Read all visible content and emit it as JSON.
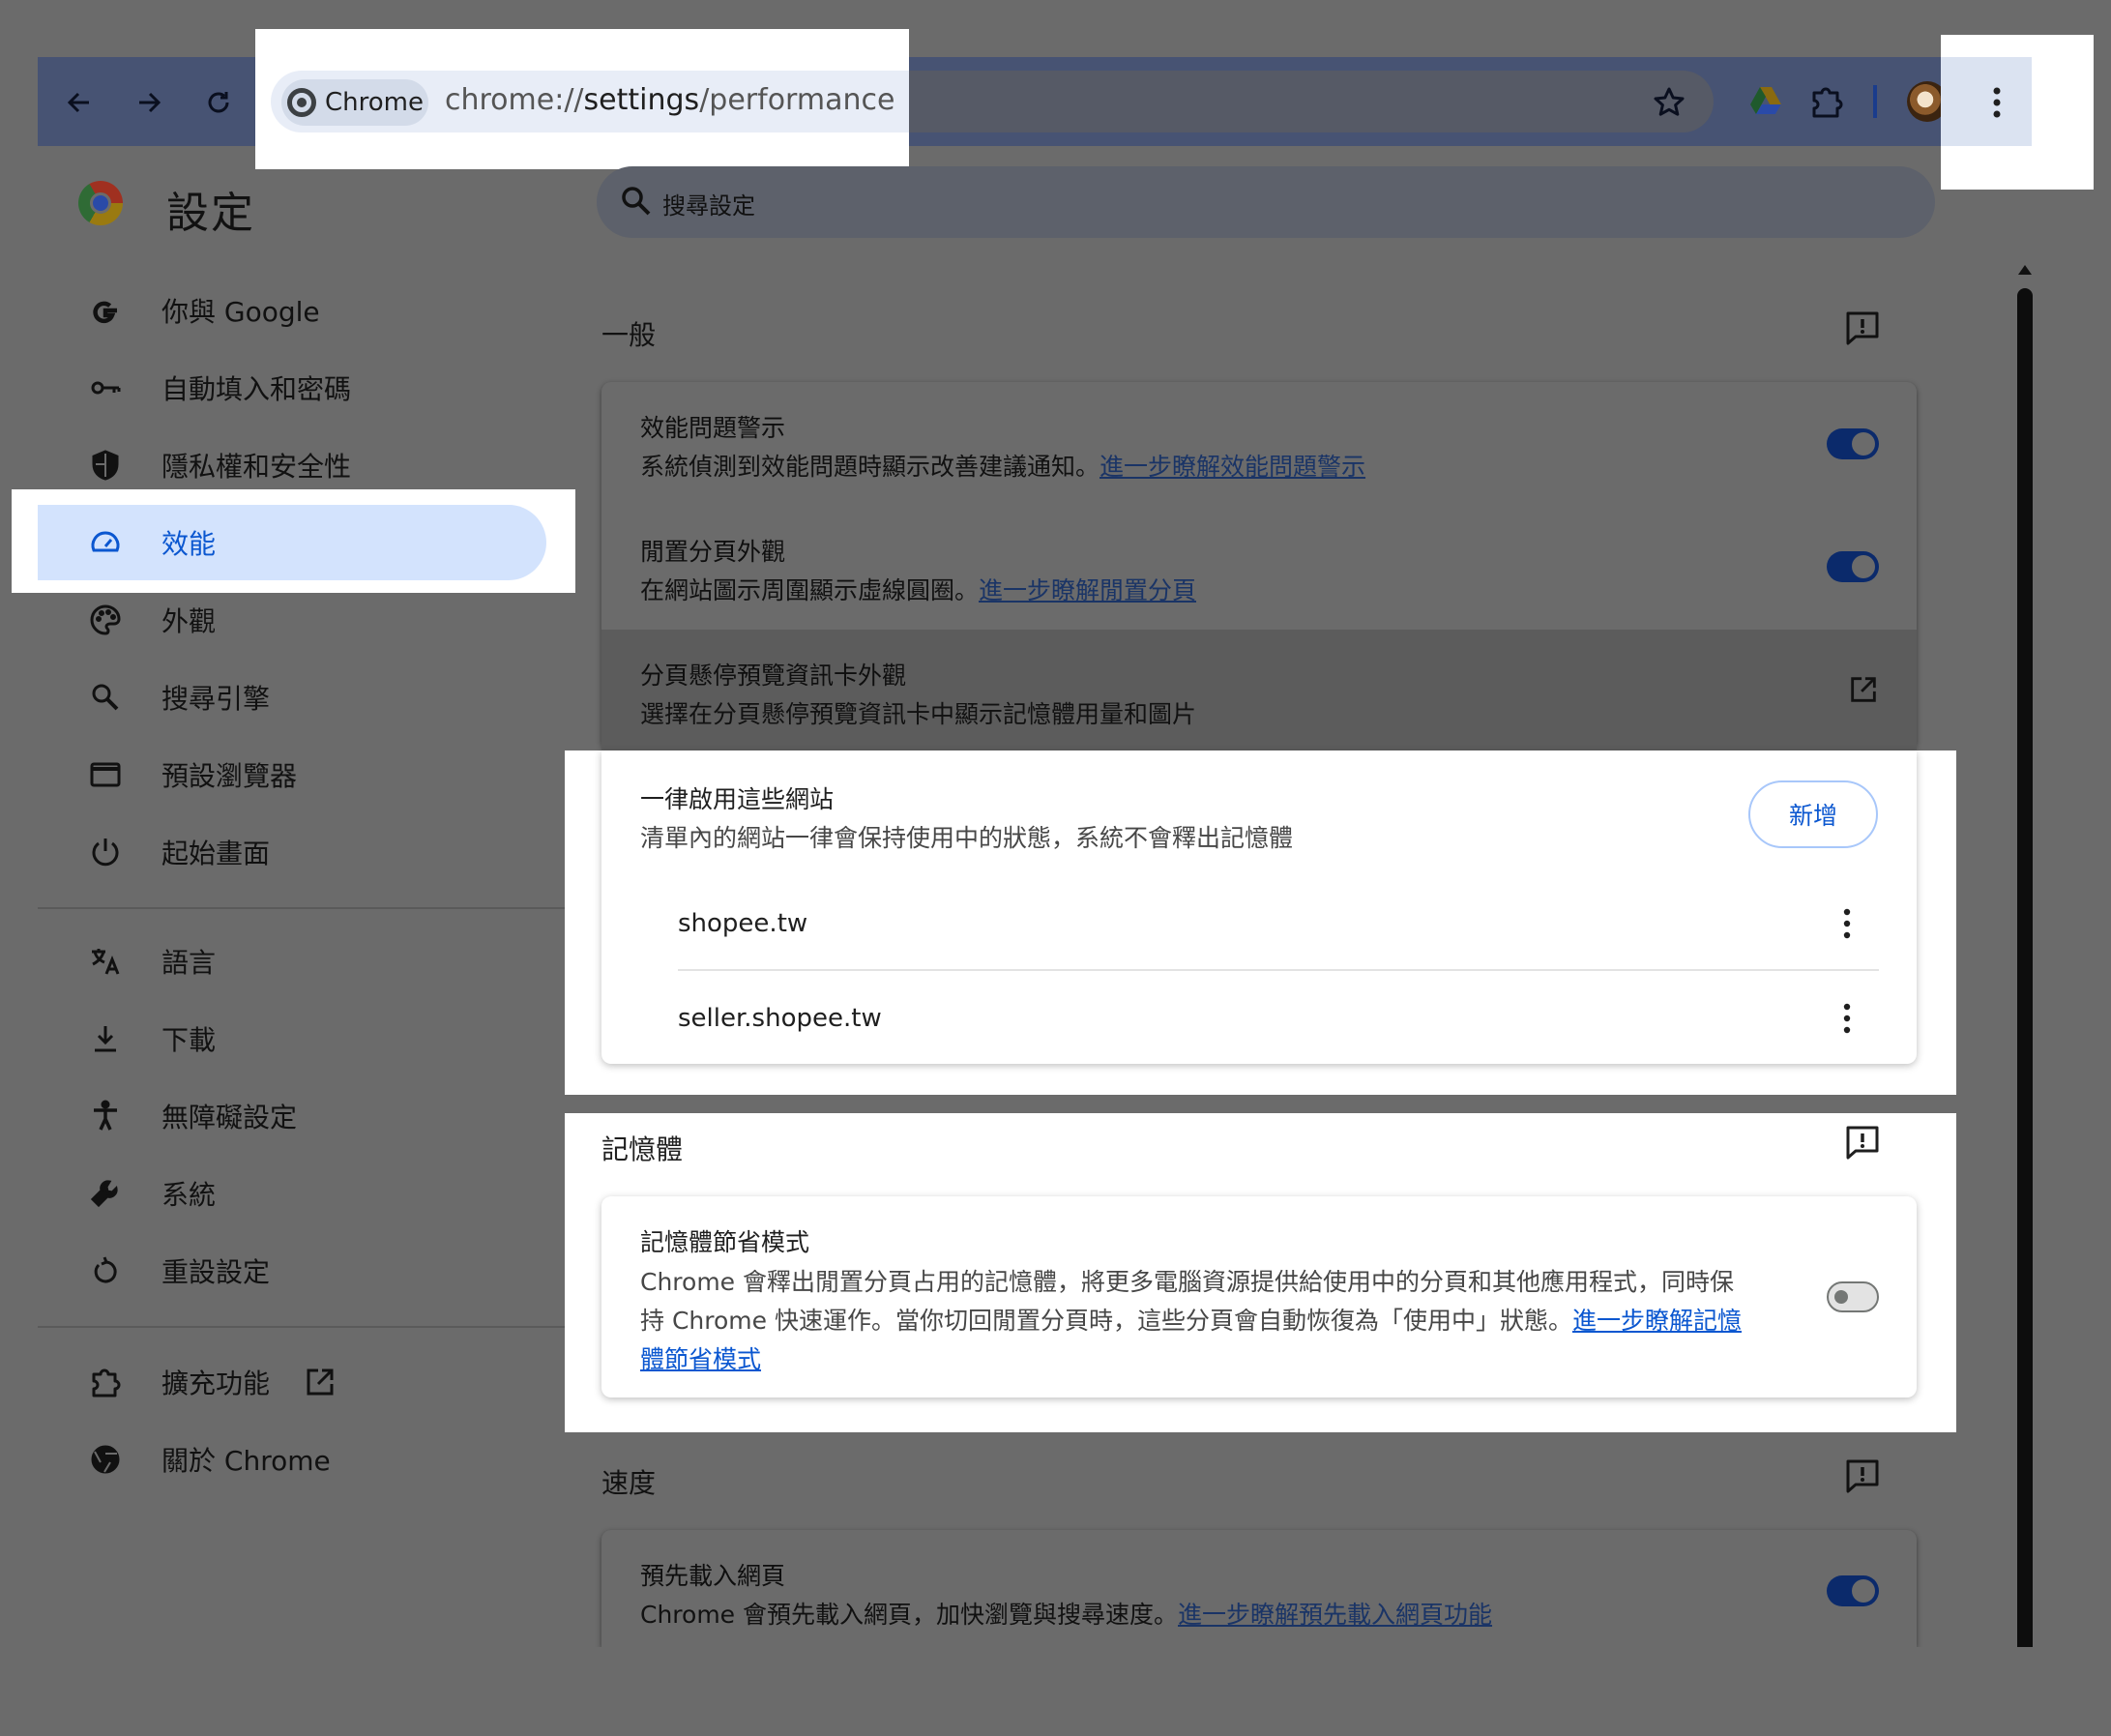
{
  "toolbar": {
    "chip_label": "Chrome",
    "url_prefix": "chrome://",
    "url_path": "settings",
    "url_suffix": "/performance"
  },
  "header": {
    "title": "設定"
  },
  "search": {
    "placeholder": "搜尋設定"
  },
  "sidebar": {
    "items": [
      {
        "label": "你與 Google",
        "icon": "google-g-icon"
      },
      {
        "label": "自動填入和密碼",
        "icon": "key-icon"
      },
      {
        "label": "隱私權和安全性",
        "icon": "shield-icon"
      },
      {
        "label": "效能",
        "icon": "speedometer-icon",
        "active": true
      },
      {
        "label": "外觀",
        "icon": "palette-icon"
      },
      {
        "label": "搜尋引擎",
        "icon": "search-icon"
      },
      {
        "label": "預設瀏覽器",
        "icon": "browser-window-icon"
      },
      {
        "label": "起始畫面",
        "icon": "power-icon"
      },
      {
        "label": "語言",
        "icon": "translate-icon"
      },
      {
        "label": "下載",
        "icon": "download-icon"
      },
      {
        "label": "無障礙設定",
        "icon": "accessibility-icon"
      },
      {
        "label": "系統",
        "icon": "wrench-icon"
      },
      {
        "label": "重設設定",
        "icon": "reset-icon"
      },
      {
        "label": "擴充功能",
        "icon": "puzzle-icon"
      },
      {
        "label": "關於 Chrome",
        "icon": "chrome-icon"
      }
    ]
  },
  "general": {
    "title": "一般",
    "perf_alerts": {
      "title": "效能問題警示",
      "desc": "系統偵測到效能問題時顯示改善建議通知。",
      "link": "進一步瞭解效能問題警示",
      "enabled": true
    },
    "inactive_tabs": {
      "title": "閒置分頁外觀",
      "desc": "在網站圖示周圍顯示虛線圓圈。",
      "link": "進一步瞭解閒置分頁",
      "enabled": true
    },
    "hover_card": {
      "title": "分頁懸停預覽資訊卡外觀",
      "desc": "選擇在分頁懸停預覽資訊卡中顯示記憶體用量和圖片"
    },
    "always_active": {
      "title": "一律啟用這些網站",
      "desc": "清單內的網站一律會保持使用中的狀態，系統不會釋出記憶體",
      "add_label": "新增",
      "sites": [
        "shopee.tw",
        "seller.shopee.tw"
      ]
    }
  },
  "memory": {
    "title": "記憶體",
    "saver": {
      "title": "記憶體節省模式",
      "desc_line1": "Chrome 會釋出閒置分頁占用的記憶體，將更多電腦資源提供給使用中的分頁和其他應用程式，同時保",
      "desc_line2": "持 Chrome 快速運作。當你切回閒置分頁時，這些分頁會自動恢復為「使用中」狀態。",
      "link_line2": "進一步瞭解記憶",
      "link_line3": "體節省模式",
      "enabled": false
    }
  },
  "speed": {
    "title": "速度",
    "preload": {
      "title": "預先載入網頁",
      "desc": "Chrome 會預先載入網頁，加快瀏覽與搜尋速度。",
      "link": "進一步瞭解預先載入網頁功能",
      "enabled": true
    }
  }
}
